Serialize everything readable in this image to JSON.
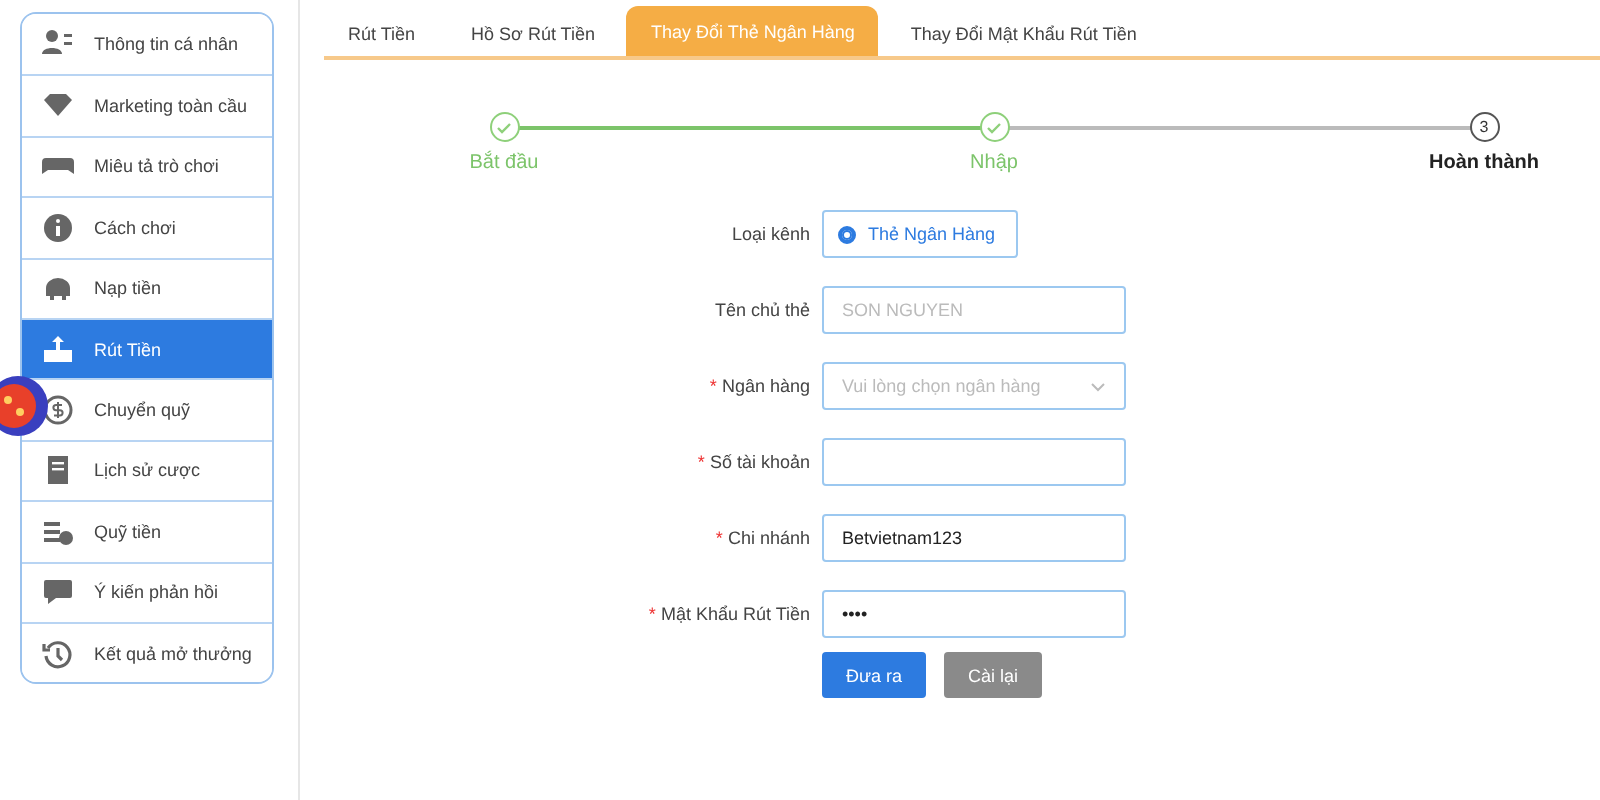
{
  "sidebar": {
    "items": [
      {
        "label": "Thông tin cá nhân",
        "selected": false
      },
      {
        "label": "Marketing toàn cầu",
        "selected": false
      },
      {
        "label": "Miêu tả trò chơi",
        "selected": false
      },
      {
        "label": "Cách chơi",
        "selected": false
      },
      {
        "label": "Nạp tiền",
        "selected": false
      },
      {
        "label": "Rút Tiền",
        "selected": true
      },
      {
        "label": "Chuyển quỹ",
        "selected": false
      },
      {
        "label": "Lịch sử cược",
        "selected": false
      },
      {
        "label": "Quỹ tiền",
        "selected": false
      },
      {
        "label": "Ý kiến phản hồi",
        "selected": false
      },
      {
        "label": "Kết quả mở thưởng",
        "selected": false
      }
    ]
  },
  "tabs": [
    {
      "label": "Rút Tiền",
      "selected": false
    },
    {
      "label": "Hồ Sơ Rút Tiền",
      "selected": false
    },
    {
      "label": "Thay Đổi Thẻ Ngân Hàng",
      "selected": true
    },
    {
      "label": "Thay Đổi Mật Khẩu Rút Tiền",
      "selected": false
    }
  ],
  "steps": [
    {
      "label": "Bắt đầu",
      "done": true
    },
    {
      "label": "Nhập",
      "done": true
    },
    {
      "label": "Hoàn thành",
      "number": "3",
      "done": false
    }
  ],
  "form": {
    "fields": [
      {
        "kind": "radio",
        "label": "Loại kênh",
        "option": "Thẻ Ngân Hàng",
        "checked": true
      },
      {
        "kind": "text",
        "label": "Tên chủ thẻ",
        "placeholder": "SON NGUYEN"
      },
      {
        "kind": "select",
        "label": "Ngân hàng",
        "mark": "*",
        "placeholder": "Vui lòng chọn ngân hàng"
      },
      {
        "kind": "text",
        "label": "Số tài khoản",
        "mark": "*"
      },
      {
        "kind": "text",
        "label": "Chi nhánh",
        "mark": "*",
        "value": "Betvietnam123"
      },
      {
        "kind": "text",
        "label": "Mật Khẩu Rút Tiền",
        "mark": "*",
        "value": "••••"
      }
    ],
    "buttons": [
      {
        "label": "Đưa ra",
        "kind": "primary"
      },
      {
        "label": "Cài lại",
        "kind": "secondary"
      }
    ]
  }
}
